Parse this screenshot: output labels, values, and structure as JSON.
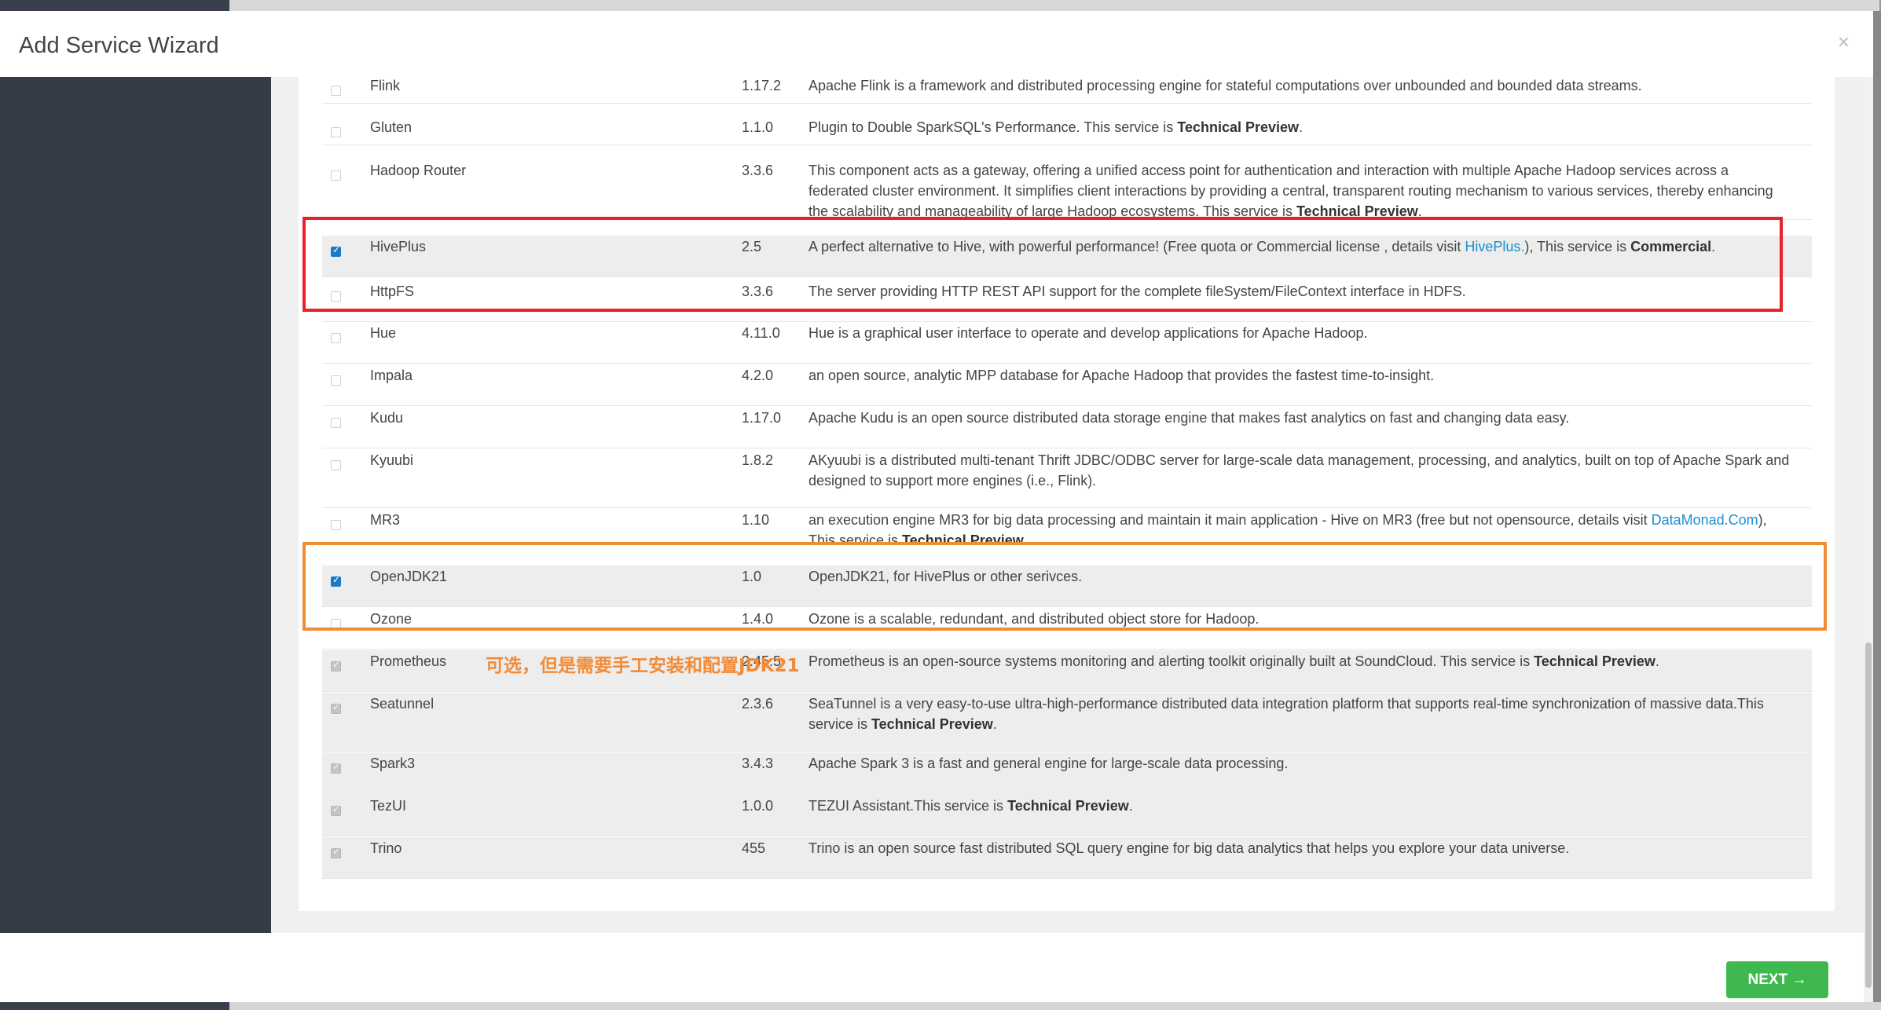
{
  "window": {
    "title": "Add Service Wizard"
  },
  "buttons": {
    "close": "×",
    "next": "NEXT →"
  },
  "annotation": "可选，但是需要手工安装和配置JDK21",
  "services": [
    {
      "name": "Flink",
      "version": "1.17.2",
      "desc": "Apache Flink is a framework and distributed processing engine for stateful computations over unbounded and bounded data streams.",
      "state": "unchecked"
    },
    {
      "name": "Gluten",
      "version": "1.1.0",
      "desc_html": "Plugin to Double SparkSQL's Performance. This service is <b>Technical Preview</b>.",
      "state": "unchecked"
    },
    {
      "name": "Hadoop Router",
      "version": "3.3.6",
      "desc_html": "This component acts as a gateway, offering a unified access point for authentication and interaction with multiple Apache Hadoop services across a federated cluster environment. It simplifies client interactions by providing a central, transparent routing mechanism to various services, thereby enhancing the scalability and manageability of large Hadoop ecosystems. This service is <b>Technical Preview</b>.",
      "state": "unchecked"
    },
    {
      "name": "HivePlus",
      "version": "2.5",
      "desc_html": "A perfect alternative to Hive, with powerful performance!  (Free quota or Commercial license , details visit <a>HivePlus.</a>), This service is <b>Commercial</b>.",
      "state": "checked"
    },
    {
      "name": "HttpFS",
      "version": "3.3.6",
      "desc": "The server providing HTTP REST API support for the complete fileSystem/FileContext interface in HDFS.",
      "state": "unchecked"
    },
    {
      "name": "Hue",
      "version": "4.11.0",
      "desc": "Hue is a graphical user interface to operate and develop applications for Apache Hadoop.",
      "state": "unchecked"
    },
    {
      "name": "Impala",
      "version": "4.2.0",
      "desc": "an open source, analytic MPP database for Apache Hadoop that provides the fastest time-to-insight.",
      "state": "unchecked"
    },
    {
      "name": "Kudu",
      "version": "1.17.0",
      "desc": "Apache Kudu is an open source distributed data storage engine that makes fast analytics on fast and changing data easy.",
      "state": "unchecked"
    },
    {
      "name": "Kyuubi",
      "version": "1.8.2",
      "desc": "AKyuubi is a distributed multi-tenant Thrift JDBC/ODBC server for large-scale data management, processing, and analytics, built on top of Apache Spark and designed to support more engines (i.e., Flink).",
      "state": "unchecked"
    },
    {
      "name": "MR3",
      "version": "1.10",
      "desc_html": "an execution engine MR3 for big data processing and maintain it main application - Hive on MR3  (free but not opensource, details visit <a>DataMonad.Com</a>), This service is <b>Technical Preview</b>.",
      "state": "unchecked"
    },
    {
      "name": "OpenJDK21",
      "version": "1.0",
      "desc": "OpenJDK21, for HivePlus or other serivces.",
      "state": "checked"
    },
    {
      "name": "Ozone",
      "version": "1.4.0",
      "desc": "Ozone is a scalable, redundant, and distributed object store for Hadoop.",
      "state": "unchecked"
    },
    {
      "name": "Prometheus",
      "version": "2.45.5",
      "desc_html": "Prometheus is an open-source systems monitoring and alerting toolkit originally built at SoundCloud. This service is <b>Technical Preview</b>.",
      "state": "installed"
    },
    {
      "name": "Seatunnel",
      "version": "2.3.6",
      "desc_html": "SeaTunnel is a very easy-to-use ultra-high-performance distributed data integration platform that supports real-time synchronization of massive data.This service is <b>Technical Preview</b>.",
      "state": "installed"
    },
    {
      "name": "Spark3",
      "version": "3.4.3",
      "desc": "Apache Spark 3 is a fast and general engine for large-scale data processing.",
      "state": "installed"
    },
    {
      "name": "TezUI",
      "version": "1.0.0",
      "desc_html": "TEZUI Assistant.This service is <b>Technical Preview</b>.",
      "state": "installed"
    },
    {
      "name": "Trino",
      "version": "455",
      "desc": "Trino is an open source fast distributed SQL query engine for big data analytics that helps you explore your data universe.",
      "state": "installed"
    }
  ]
}
